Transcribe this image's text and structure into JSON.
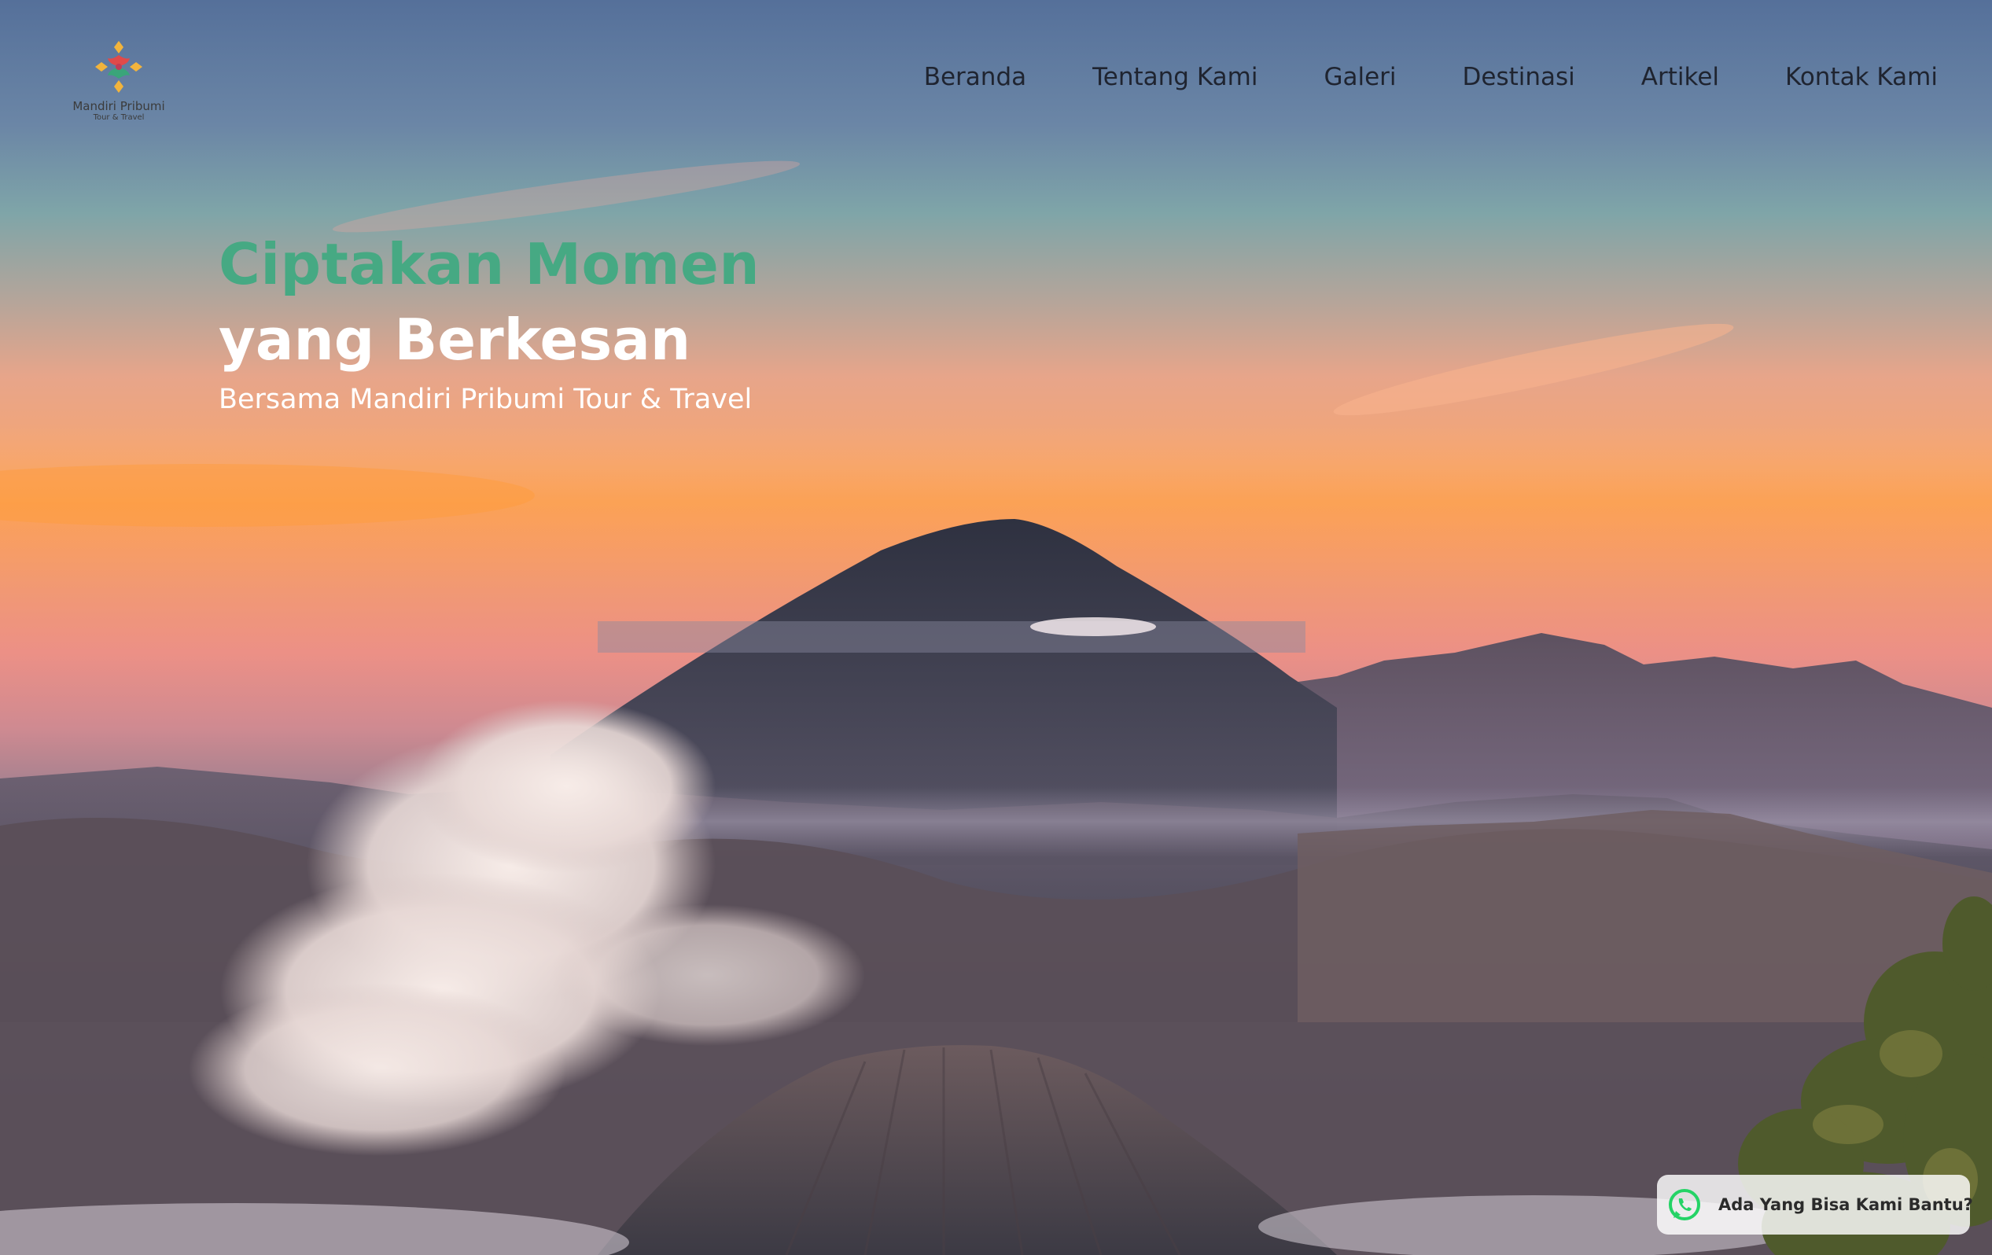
{
  "brand": {
    "name": "Mandiri Pribumi",
    "subtitle": "Tour & Travel",
    "logo_icon": "flower-diamond-logo"
  },
  "nav": {
    "items": [
      {
        "label": "Beranda"
      },
      {
        "label": "Tentang Kami"
      },
      {
        "label": "Galeri"
      },
      {
        "label": "Destinasi"
      },
      {
        "label": "Artikel"
      },
      {
        "label": "Kontak Kami"
      }
    ]
  },
  "hero": {
    "headline_line1": "Ciptakan Momen",
    "headline_line2": "yang Berkesan",
    "tagline": "Bersama Mandiri Pribumi Tour & Travel",
    "background_image": "volcano-sunrise-landscape"
  },
  "chat_widget": {
    "label": "Ada Yang Bisa Kami Bantu?",
    "icon": "whatsapp-icon"
  },
  "colors": {
    "accent_green": "#46a983",
    "whatsapp_green": "#25d366",
    "nav_text": "#1f2430",
    "headline_white": "#ffffff"
  }
}
